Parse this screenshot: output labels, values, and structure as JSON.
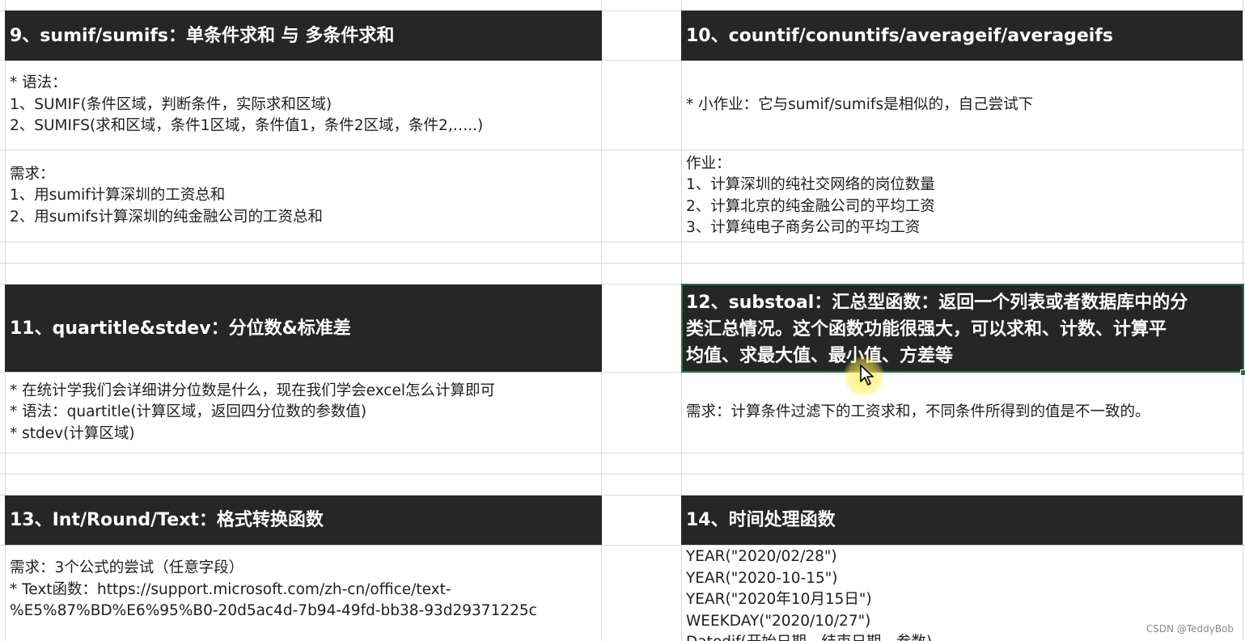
{
  "sections": {
    "s9": {
      "header": "9、sumif/sumifs：单条件求和  与 多条件求和",
      "syntax": "* 语法：\n1、SUMIF(条件区域，判断条件，实际求和区域)\n2、SUMIFS(求和区域，条件1区域，条件值1，条件2区域，条件2,…..)",
      "needs": "需求：\n1、用sumif计算深圳的工资总和\n2、用sumifs计算深圳的纯金融公司的工资总和"
    },
    "s10": {
      "header": "10、countif/conuntifs/averageif/averageifs",
      "task": "* 小作业：它与sumif/sumifs是相似的，自己尝试下",
      "homework": "作业：\n1、计算深圳的纯社交网络的岗位数量\n2、计算北京的纯金融公司的平均工资\n3、计算纯电子商务公司的平均工资"
    },
    "s11": {
      "header": "11、quartitle&stdev：分位数&标准差",
      "body": "* 在统计学我们会详细讲分位数是什么，现在我们学会excel怎么计算即可\n* 语法：quartitle(计算区域，返回四分位数的参数值)\n* stdev(计算区域)"
    },
    "s12": {
      "header": "12、substoal：汇总型函数：返回一个列表或者数据库中的分\n类汇总情况。这个函数功能很强大，可以求和、计数、计算平\n均值、求最大值、最小值、方差等",
      "body": "需求：计算条件过滤下的工资求和，不同条件所得到的值是不一致的。"
    },
    "s13": {
      "header": "13、Int/Round/Text：格式转换函数",
      "body": "需求：3个公式的尝试（任意字段）\n* Text函数：https://support.microsoft.com/zh-cn/office/text-\n%E5%87%BD%E6%95%B0-20d5ac4d-7b94-49fd-bb38-93d29371225c"
    },
    "s14": {
      "header": "14、时间处理函数",
      "body": "YEAR(\"2020/02/28\")\nYEAR(\"2020-10-15\")\nYEAR(\"2020年10月15日\")\nWEEKDAY(\"2020/10/27\")\nDatedif(开始日期，结束日期，参数)"
    }
  },
  "watermark": "CSDN @TeddyBob",
  "colors": {
    "header_bg": "#262626",
    "header_text": "#ffffff",
    "grid": "#d9d9d9",
    "selection": "#217346"
  }
}
